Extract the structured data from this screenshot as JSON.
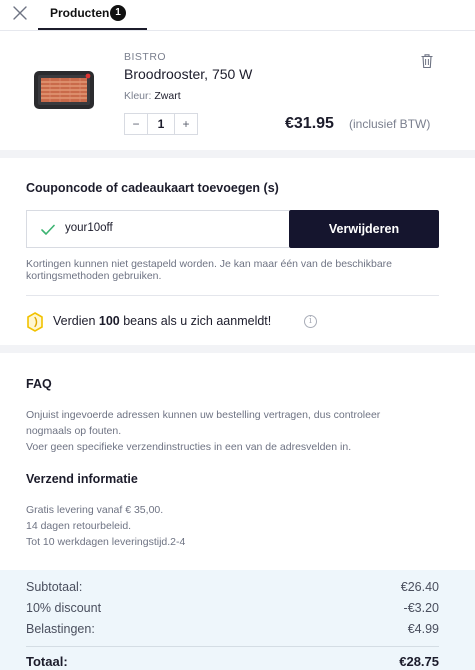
{
  "header": {
    "tab_label": "Producten",
    "tab_count": "1"
  },
  "product": {
    "brand": "BISTRO",
    "name": "Broodrooster, 750 W",
    "color_label": "Kleur:",
    "color_value": "Zwart",
    "quantity": "1",
    "minus": "−",
    "plus": "+",
    "price": "€31.95",
    "price_note": "(inclusief BTW)"
  },
  "coupon": {
    "title": "Couponcode of cadeaukaart toevoegen (s)",
    "value": "your10off",
    "remove_label": "Verwijderen",
    "note": "Kortingen kunnen niet gestapeld worden. Je kan maar één van de beschikbare kortingsmethoden gebruiken.",
    "beans_prefix": "Verdien",
    "beans_amount": "100",
    "beans_suffix": "beans als u zich aanmeldt!"
  },
  "faq": {
    "title": "FAQ",
    "text": "Onjuist ingevoerde adressen kunnen uw bestelling vertragen, dus controleer nogmaals op fouten. Voer geen specifieke verzendinstructies in een van de adresvelden in.",
    "line1": "Onjuist ingevoerde adressen kunnen uw bestelling vertragen, dus controleer",
    "line2": "nogmaals op fouten.",
    "line3": "Voer geen specifieke verzendinstructies in een van de adresvelden in."
  },
  "shipping": {
    "title": "Verzend informatie",
    "lines": [
      "Gratis levering vanaf € 35,00.",
      "14 dagen retourbeleid.",
      "Tot 10 werkdagen leveringstijd.2-4"
    ]
  },
  "summary": {
    "subtotal_label": "Subtotaal:",
    "subtotal_value": "€26.40",
    "discount_label": "10% discount",
    "discount_value": "-€3.20",
    "tax_label": "Belastingen:",
    "tax_value": "€4.99",
    "total_label": "Totaal:",
    "total_value": "€28.75"
  },
  "colors": {
    "accent_dark": "#15152e",
    "check_green": "#3cb371",
    "beans_yellow": "#f2c200",
    "summary_bg": "#eef6fb"
  },
  "icons": [
    "close-icon",
    "trash-icon",
    "check-icon",
    "bean-icon",
    "info-icon"
  ]
}
